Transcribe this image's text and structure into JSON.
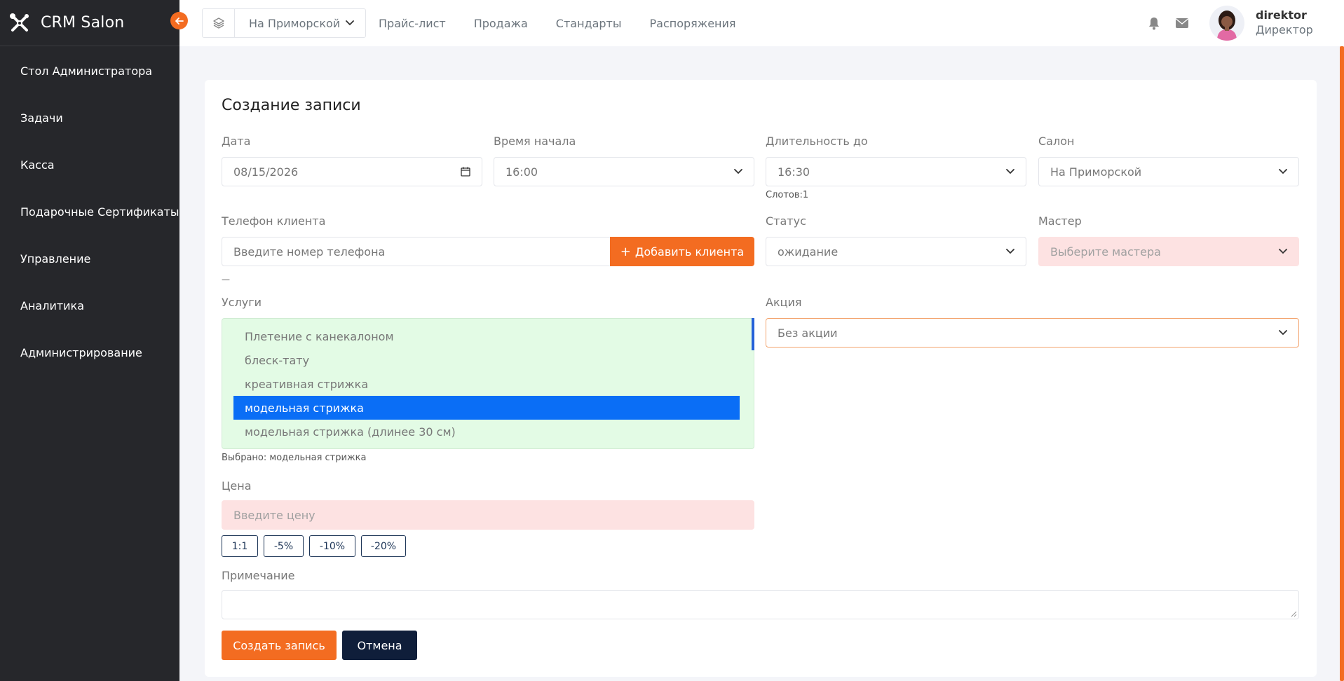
{
  "app": {
    "name": "CRM Salon",
    "logo_icon": "crossed-tools-icon"
  },
  "colors": {
    "accent": "#f36c21",
    "sidebar": "#26272b",
    "selected": "#0a6ef6",
    "navy": "#0f1e3a",
    "invalid_bg": "#fde2e2",
    "services_bg": "#e3fbe5"
  },
  "sidebar": {
    "items": [
      {
        "label": "Стол Администратора"
      },
      {
        "label": "Задачи"
      },
      {
        "label": "Касса"
      },
      {
        "label": "Подарочные Сертификаты"
      },
      {
        "label": "Управление"
      },
      {
        "label": "Аналитика"
      },
      {
        "label": "Администрирование"
      }
    ]
  },
  "topbar": {
    "salon_selected": "На Приморской",
    "nav": [
      {
        "label": "Прайс-лист"
      },
      {
        "label": "Продажа"
      },
      {
        "label": "Стандарты"
      },
      {
        "label": "Распоряжения"
      }
    ],
    "user": {
      "name": "direktor",
      "role": "Директор"
    }
  },
  "form": {
    "title": "Создание записи",
    "date": {
      "label": "Дата",
      "value": "08/15/2026"
    },
    "start_time": {
      "label": "Время начала",
      "value": "16:00"
    },
    "duration": {
      "label": "Длительность до",
      "value": "16:30",
      "hint": "Слотов:1"
    },
    "salon": {
      "label": "Салон",
      "value": "На Приморской"
    },
    "phone": {
      "label": "Телефон клиента",
      "placeholder": "Введите номер телефона",
      "hint": "—"
    },
    "add_client_label": "Добавить клиента",
    "status": {
      "label": "Статус",
      "value": "ожидание"
    },
    "master": {
      "label": "Мастер",
      "placeholder": "Выберите мастера"
    },
    "services": {
      "label": "Услуги",
      "items": [
        {
          "label": "Плетение с канекалоном",
          "selected": false
        },
        {
          "label": "блеск-тату",
          "selected": false
        },
        {
          "label": "креативная стрижка",
          "selected": false
        },
        {
          "label": "модельная стрижка",
          "selected": true
        },
        {
          "label": "модельная стрижка (длинее 30 см)",
          "selected": false
        }
      ],
      "selected_text": "Выбрано: модельная стрижка"
    },
    "promo": {
      "label": "Акция",
      "value": "Без акции"
    },
    "price": {
      "label": "Цена",
      "placeholder": "Введите цену",
      "buttons": [
        "1:1",
        "-5%",
        "-10%",
        "-20%"
      ]
    },
    "note": {
      "label": "Примечание",
      "value": ""
    },
    "submit_label": "Создать запись",
    "cancel_label": "Отмена"
  }
}
